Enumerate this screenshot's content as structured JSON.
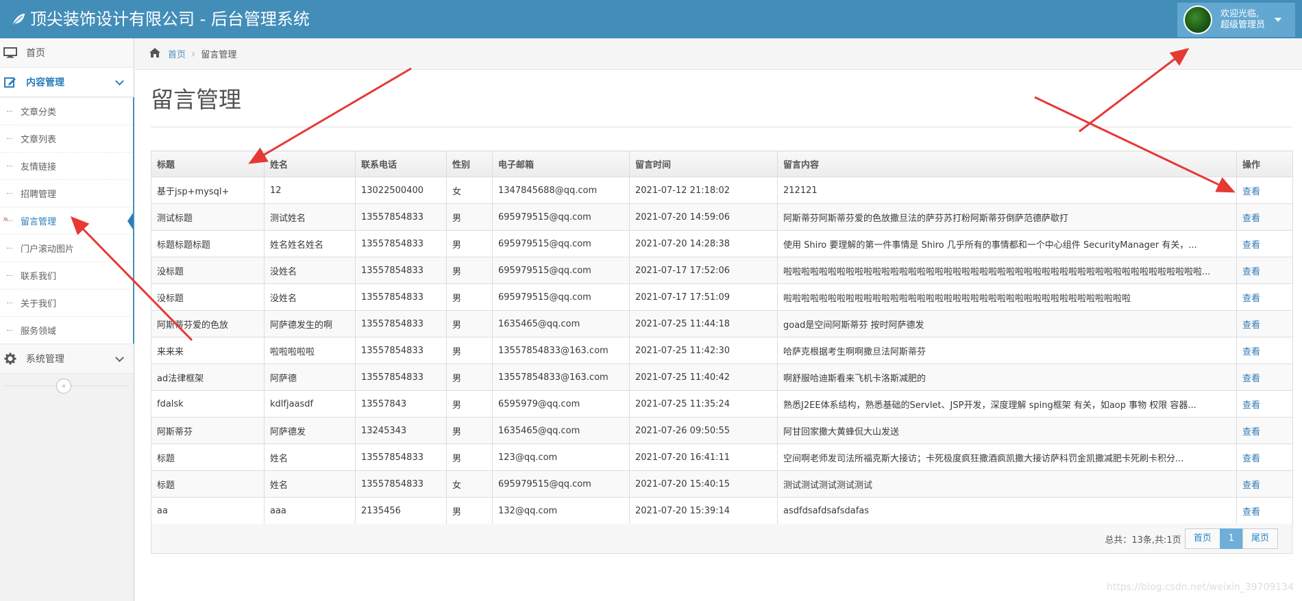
{
  "header": {
    "title": "顶尖装饰设计有限公司 - 后台管理系统",
    "user_greeting": "欢迎光临,",
    "user_role": "超级管理员"
  },
  "sidebar": {
    "home": "首页",
    "content_menu": "内容管理",
    "content_items": [
      "文章分类",
      "文章列表",
      "友情链接",
      "招聘管理",
      "留言管理",
      "门户滚动图片",
      "联系我们",
      "关于我们",
      "服务领域"
    ],
    "active_item": "留言管理",
    "system_menu": "系统管理"
  },
  "breadcrumb": {
    "home": "首页",
    "current": "留言管理"
  },
  "page": {
    "title": "留言管理"
  },
  "table": {
    "columns": [
      "标题",
      "姓名",
      "联系电话",
      "性别",
      "电子邮箱",
      "留言时间",
      "留言内容",
      "操作"
    ],
    "action_label": "查看",
    "rows": [
      [
        "基于jsp+mysql+",
        "12",
        "13022500400",
        "女",
        "1347845688@qq.com",
        "2021-07-12 21:18:02",
        "212121"
      ],
      [
        "测试标题",
        "测试姓名",
        "13557854833",
        "男",
        "695979515@qq.com",
        "2021-07-20 14:59:06",
        "阿斯蒂芬阿斯蒂芬爱的色放撒旦法的萨芬苏打粉阿斯蒂芬倒萨范德萨歇打"
      ],
      [
        "标题标题标题",
        "姓名姓名姓名",
        "13557854833",
        "男",
        "695979515@qq.com",
        "2021-07-20 14:28:38",
        "使用 Shiro 要理解的第一件事情是 Shiro 几乎所有的事情都和一个中心组件 SecurityManager 有关，..."
      ],
      [
        "没标题",
        "没姓名",
        "13557854833",
        "男",
        "695979515@qq.com",
        "2021-07-17 17:52:06",
        "啦啦啦啦啦啦啦啦啦啦啦啦啦啦啦啦啦啦啦啦啦啦啦啦啦啦啦啦啦啦啦啦啦啦啦啦啦啦啦啦啦啦啦啦啦啦啦..."
      ],
      [
        "没标题",
        "没姓名",
        "13557854833",
        "男",
        "695979515@qq.com",
        "2021-07-17 17:51:09",
        "啦啦啦啦啦啦啦啦啦啦啦啦啦啦啦啦啦啦啦啦啦啦啦啦啦啦啦啦啦啦啦啦啦啦啦啦啦啦啦"
      ],
      [
        "阿斯蒂芬爱的色放",
        "阿萨德发生的啊",
        "13557854833",
        "男",
        "1635465@qq.com",
        "2021-07-25 11:44:18",
        "goad是空间阿斯蒂芬 按时阿萨德发"
      ],
      [
        "来来来",
        "啦啦啦啦啦",
        "13557854833",
        "男",
        "13557854833@163.com",
        "2021-07-25 11:42:30",
        "哈萨克根据考生啊啊撒旦法阿斯蒂芬"
      ],
      [
        "ad法律框架",
        "阿萨德",
        "13557854833",
        "男",
        "13557854833@163.com",
        "2021-07-25 11:40:42",
        "啊舒服哈迪斯看来飞机卡洛斯减肥的"
      ],
      [
        "fdalsk",
        "kdlfjaasdf",
        "13557843",
        "男",
        "6595979@qq.com",
        "2021-07-25 11:35:24",
        "熟悉J2EE体系结构，熟悉基础的Servlet、JSP开发，深度理解 sping框架 有关，如aop 事物 权限 容器..."
      ],
      [
        "阿斯蒂芬",
        "阿萨德发",
        "13245343",
        "男",
        "1635465@qq.com",
        "2021-07-26 09:50:55",
        "阿甘回家撒大黄蜂侃大山发送"
      ],
      [
        "标题",
        "姓名",
        "13557854833",
        "男",
        "123@qq.com",
        "2021-07-20 16:41:11",
        "空间啊老师发司法所福克斯大接访；卡死极度疯狂撒酒疯凯撒大接访萨科罚金凯撒减肥卡死刷卡积分..."
      ],
      [
        "标题",
        "姓名",
        "13557854833",
        "女",
        "695979515@qq.com",
        "2021-07-20 15:40:15",
        "测试测试测试测试测试"
      ],
      [
        "aa",
        "aaa",
        "2135456",
        "男",
        "132@qq.com",
        "2021-07-20 15:39:14",
        "asdfdsafdsafsdafas"
      ]
    ]
  },
  "pager": {
    "summary": "总共：13条,共:1页",
    "first": "首页",
    "current": "1",
    "last": "尾页"
  },
  "watermark": "https://blog.csdn.net/weixin_39709134",
  "colors": {
    "header_bg": "#438eb9",
    "user_box_bg": "#62a8d1",
    "link": "#337ab7",
    "annotation_arrow": "#e53935"
  }
}
